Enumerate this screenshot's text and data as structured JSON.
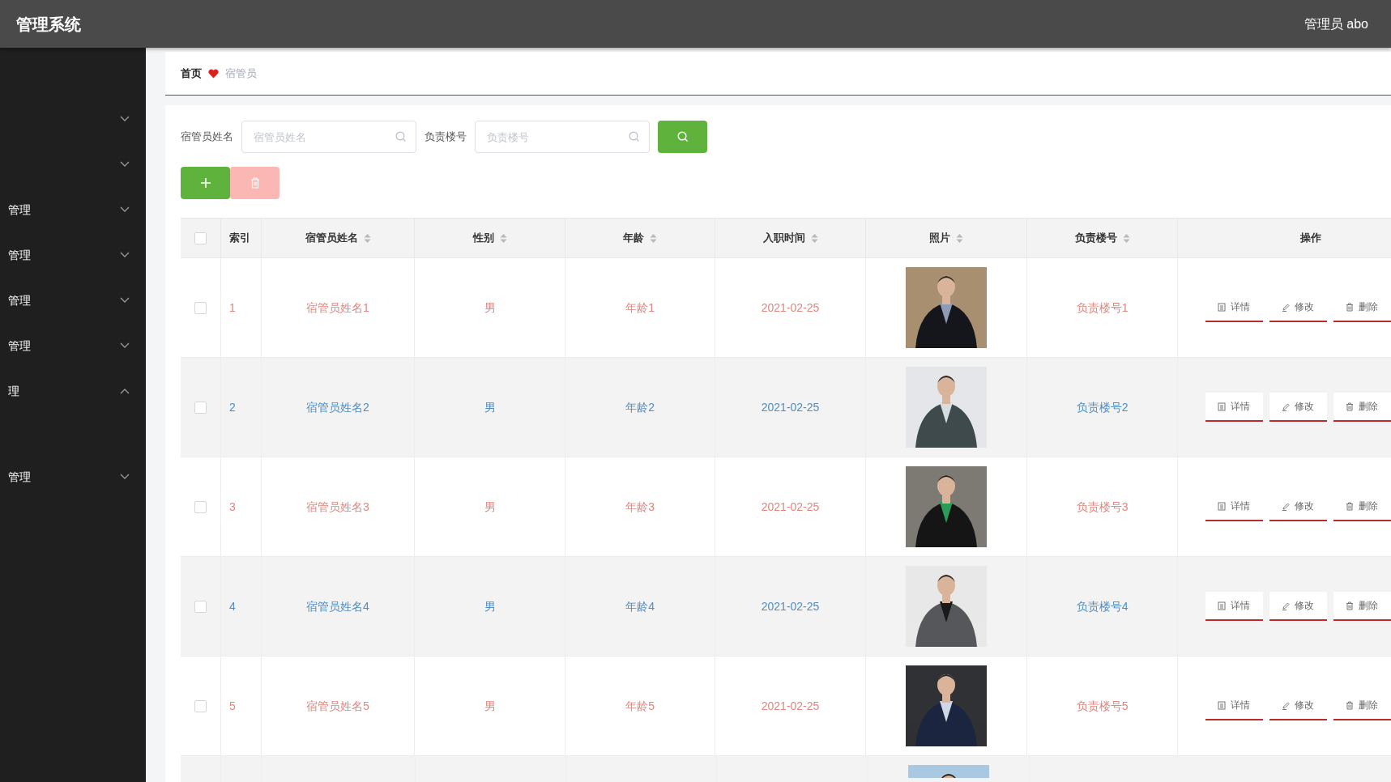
{
  "app": {
    "title": "管理系统",
    "user": "管理员 abo"
  },
  "sidebar": {
    "items": [
      {
        "expanded": false
      },
      {
        "expanded": false
      },
      {
        "label": "管理",
        "expanded": false
      },
      {
        "label": "管理",
        "expanded": false
      },
      {
        "label": "管理",
        "expanded": false
      },
      {
        "label": "管理",
        "expanded": false
      },
      {
        "label": "理",
        "expanded": true
      },
      {
        "label": "管理",
        "expanded": false
      }
    ]
  },
  "breadcrumb": [
    {
      "label": "首页",
      "current": false
    },
    {
      "label": "宿管员",
      "current": true
    }
  ],
  "filters": [
    {
      "label": "宿管员姓名",
      "placeholder": "宿管员姓名"
    },
    {
      "label": "负责楼号",
      "placeholder": "负责楼号"
    }
  ],
  "toolbar": {
    "delete_disabled": true
  },
  "table": {
    "select_all_checked": false,
    "columns": [
      {
        "label": "索引",
        "sortable": false
      },
      {
        "label": "宿管员姓名",
        "sortable": true
      },
      {
        "label": "性别",
        "sortable": true
      },
      {
        "label": "年龄",
        "sortable": true
      },
      {
        "label": "入职时间",
        "sortable": true
      },
      {
        "label": "照片",
        "sortable": true
      },
      {
        "label": "负责楼号",
        "sortable": true
      },
      {
        "label": "操作",
        "sortable": false
      }
    ],
    "rows": [
      {
        "checked": false,
        "color": "#e0867f",
        "index": "1",
        "name": "宿管员姓名1",
        "gender": "男",
        "age": "年龄1",
        "date": "2021-02-25",
        "floor": "负责楼号1",
        "actions": [
          "详情",
          "修改",
          "删除"
        ]
      },
      {
        "checked": false,
        "color": "#4f8dc2",
        "index": "2",
        "name": "宿管员姓名2",
        "gender": "男",
        "age": "年龄2",
        "date": "2021-02-25",
        "floor": "负责楼号2",
        "actions": [
          "详情",
          "修改",
          "删除"
        ]
      },
      {
        "checked": false,
        "color": "#e0867f",
        "index": "3",
        "name": "宿管员姓名3",
        "gender": "男",
        "age": "年龄3",
        "date": "2021-02-25",
        "floor": "负责楼号3",
        "actions": [
          "详情",
          "修改",
          "删除"
        ]
      },
      {
        "checked": false,
        "color": "#4f8dc2",
        "index": "4",
        "name": "宿管员姓名4",
        "gender": "男",
        "age": "年龄4",
        "date": "2021-02-25",
        "floor": "负责楼号4",
        "actions": [
          "详情",
          "修改",
          "删除"
        ]
      },
      {
        "checked": false,
        "color": "#e0867f",
        "index": "5",
        "name": "宿管员姓名5",
        "gender": "男",
        "age": "年龄5",
        "date": "2021-02-25",
        "floor": "负责楼号5",
        "actions": [
          "详情",
          "修改",
          "删除"
        ]
      }
    ]
  }
}
